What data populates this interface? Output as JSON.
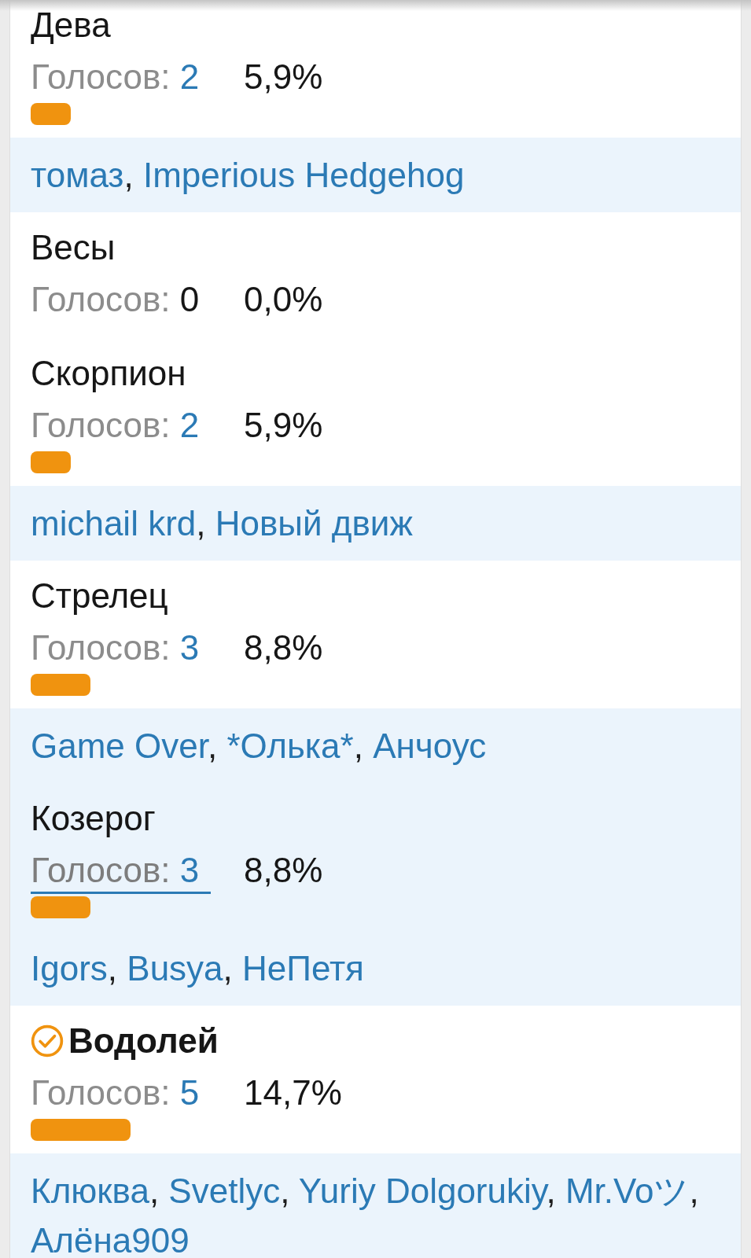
{
  "options": [
    {
      "title": "Дева",
      "voted": false,
      "hovered": false,
      "votes_label": "Голосов:",
      "votes": "2",
      "percent": "5,9%",
      "level": 0.059,
      "voters": [
        {
          "name": "томаз",
          "separator": ","
        },
        {
          "name": "Imperious Hedgehog"
        }
      ]
    },
    {
      "title": "Весы",
      "voted": false,
      "hovered": false,
      "votes_label": "Голосов:",
      "votes": "0",
      "percent": "0,0%"
    },
    {
      "title": "Скорпион",
      "voted": false,
      "hovered": false,
      "votes_label": "Голосов:",
      "votes": "2",
      "percent": "5,9%",
      "level": 0.059,
      "voters": [
        {
          "name": "michail krd",
          "separator": ","
        },
        {
          "name": "Новый движ"
        }
      ]
    },
    {
      "title": "Стрелец",
      "voted": false,
      "hovered": false,
      "votes_label": "Голосов:",
      "votes": "3",
      "percent": "8,8%",
      "level": 0.088,
      "voters": [
        {
          "name": "Game Over",
          "separator": ","
        },
        {
          "name": "*Олька*",
          "separator": ","
        },
        {
          "name": "Анчоус"
        }
      ]
    },
    {
      "title": "Козерог",
      "voted": false,
      "hovered": true,
      "votes_label": "Голосов:",
      "votes": "3",
      "percent": "8,8%",
      "level": 0.088,
      "voters": [
        {
          "name": "Igors",
          "separator": ","
        },
        {
          "name": "Busya",
          "separator": ","
        },
        {
          "name": "НеПетя"
        }
      ]
    },
    {
      "title": "Водолей",
      "voted": true,
      "hovered": false,
      "votes_label": "Голосов:",
      "votes": "5",
      "percent": "14,7%",
      "level": 0.147,
      "voters": [
        {
          "name": "Клюква",
          "separator": ","
        },
        {
          "name": "Svetlyc",
          "separator": ","
        },
        {
          "name": "Yuriy Dolgorukiy",
          "separator": ","
        },
        {
          "name": "Mr.Voツ",
          "separator": ","
        },
        {
          "name": "Алёна909"
        }
      ]
    }
  ]
}
